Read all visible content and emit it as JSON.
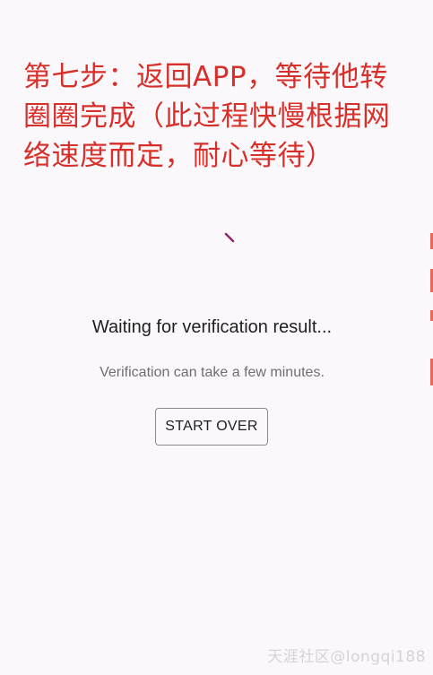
{
  "instruction": {
    "text": "第七步：返回APP，等待他转圈圈完成（此过程快慢根据网络速度而定，耐心等待）",
    "color": "#d7302a"
  },
  "verification": {
    "title": "Waiting for verification result...",
    "subtitle": "Verification can take a few minutes.",
    "start_over_label": "START OVER"
  },
  "spinner": {
    "icon": "loading-spinner-icon",
    "color": "#8a2a6e"
  },
  "watermark": {
    "text": "天涯社区@longqi188"
  }
}
